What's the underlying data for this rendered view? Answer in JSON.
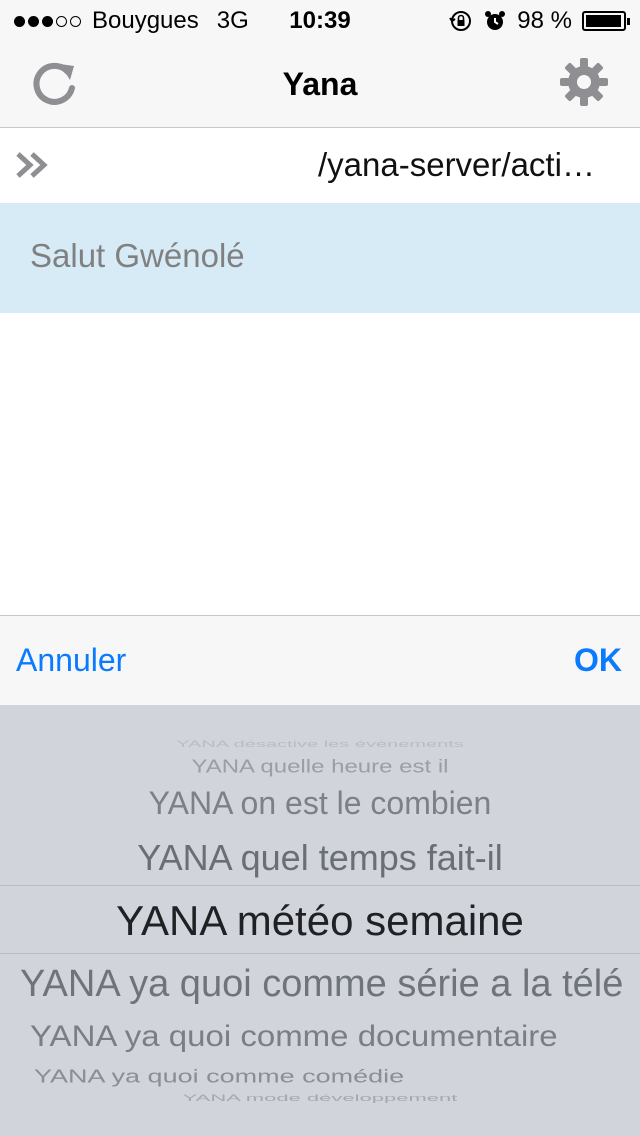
{
  "status_bar": {
    "carrier": "Bouygues",
    "network": "3G",
    "time": "10:39",
    "battery": "98 %",
    "battery_level": 0.98,
    "signal_bars": 3,
    "signal_total": 5
  },
  "nav": {
    "title": "Yana"
  },
  "path": {
    "text": "/yana-server/action.php"
  },
  "message": {
    "text": "Salut Gwénolé"
  },
  "toolbar": {
    "cancel_label": "Annuler",
    "ok_label": "OK"
  },
  "picker": {
    "items": [
      "YANA désactive les évènements",
      "YANA quelle heure est il",
      "YANA on est le combien",
      "YANA quel temps fait-il",
      "YANA météo semaine",
      "YANA ya quoi comme série a la télé",
      "YANA ya quoi comme documentaire",
      "YANA ya quoi comme comédie",
      "YANA mode développement"
    ],
    "selected": "YANA météo semaine"
  },
  "colors": {
    "accent": "#0a7aff",
    "message_bg": "#d7ebf7",
    "picker_bg": "#d1d5db"
  },
  "icons": [
    "refresh-icon",
    "settings-icon",
    "double-chevron-icon",
    "orientation-lock-icon",
    "alarm-icon"
  ]
}
